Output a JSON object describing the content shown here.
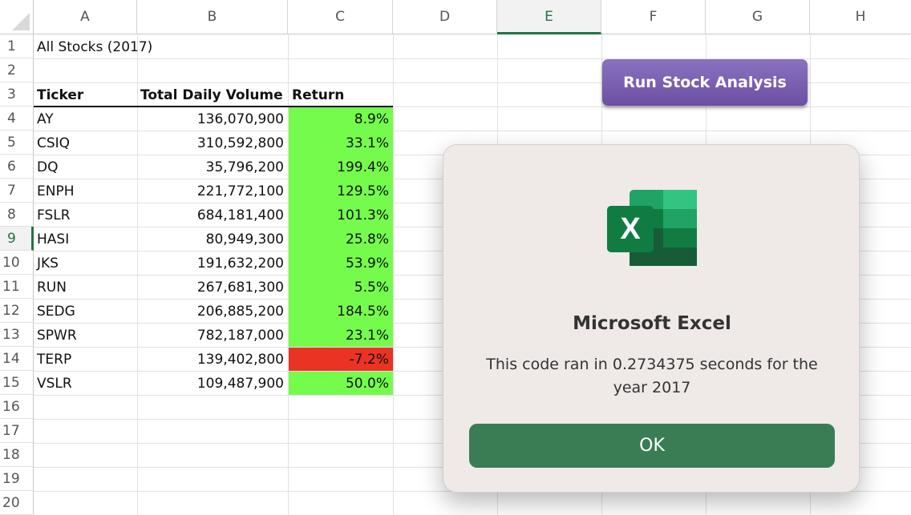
{
  "columns": [
    "A",
    "B",
    "C",
    "D",
    "E",
    "F",
    "G",
    "H"
  ],
  "selected_column": "E",
  "rows": [
    "1",
    "2",
    "3",
    "4",
    "5",
    "6",
    "7",
    "8",
    "9",
    "10",
    "11",
    "12",
    "13",
    "14",
    "15",
    "16",
    "17",
    "18",
    "19",
    "20"
  ],
  "selected_row": "9",
  "sheet": {
    "title": "All Stocks (2017)",
    "headers": {
      "ticker": "Ticker",
      "volume": "Total Daily Volume",
      "return": "Return"
    },
    "stocks": [
      {
        "ticker": "AY",
        "volume": "136,070,900",
        "return": "8.9%",
        "status": "positive"
      },
      {
        "ticker": "CSIQ",
        "volume": "310,592,800",
        "return": "33.1%",
        "status": "positive"
      },
      {
        "ticker": "DQ",
        "volume": "35,796,200",
        "return": "199.4%",
        "status": "positive"
      },
      {
        "ticker": "ENPH",
        "volume": "221,772,100",
        "return": "129.5%",
        "status": "positive"
      },
      {
        "ticker": "FSLR",
        "volume": "684,181,400",
        "return": "101.3%",
        "status": "positive"
      },
      {
        "ticker": "HASI",
        "volume": "80,949,300",
        "return": "25.8%",
        "status": "positive"
      },
      {
        "ticker": "JKS",
        "volume": "191,632,200",
        "return": "53.9%",
        "status": "positive"
      },
      {
        "ticker": "RUN",
        "volume": "267,681,300",
        "return": "5.5%",
        "status": "positive"
      },
      {
        "ticker": "SEDG",
        "volume": "206,885,200",
        "return": "184.5%",
        "status": "positive"
      },
      {
        "ticker": "SPWR",
        "volume": "782,187,000",
        "return": "23.1%",
        "status": "positive"
      },
      {
        "ticker": "TERP",
        "volume": "139,402,800",
        "return": "-7.2%",
        "status": "negative"
      },
      {
        "ticker": "VSLR",
        "volume": "109,487,900",
        "return": "50.0%",
        "status": "positive"
      }
    ]
  },
  "run_button": {
    "label": "Run Stock Analysis"
  },
  "dialog": {
    "icon": "excel-app-icon",
    "title": "Microsoft Excel",
    "message": "This code ran in 0.2734375 seconds for the year 2017",
    "ok_label": "OK"
  },
  "colors": {
    "positive_fill": "#75fb4c",
    "negative_fill": "#ea3323",
    "excel_green": "#217346",
    "button_purple": "#7b5fb2",
    "ok_button": "#3a7d54"
  }
}
